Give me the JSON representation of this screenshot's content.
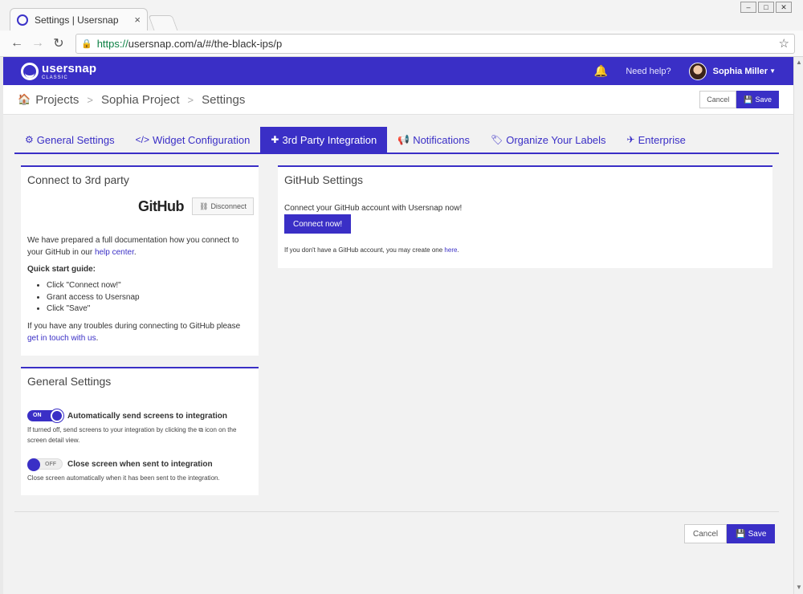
{
  "browser": {
    "tab_title": "Settings | Usersnap",
    "tab_close": "×",
    "url_scheme": "https://",
    "url_rest": "usersnap.com/a/#/the-black-ips/p"
  },
  "appbar": {
    "logo_word": "usersnap",
    "logo_sub": "CLASSIC",
    "help": "Need help?",
    "user": "Sophia Miller"
  },
  "breadcrumb": {
    "items": [
      "Projects",
      "Sophia Project",
      "Settings"
    ],
    "cancel": "Cancel",
    "save": "Save"
  },
  "tabs": [
    {
      "label": "General Settings",
      "icon": "gear-icon"
    },
    {
      "label": "Widget Configuration",
      "icon": "code-icon"
    },
    {
      "label": "3rd Party Integration",
      "icon": "puzzle-icon",
      "active": true
    },
    {
      "label": "Notifications",
      "icon": "megaphone-icon"
    },
    {
      "label": "Organize Your Labels",
      "icon": "tags-icon"
    },
    {
      "label": "Enterprise",
      "icon": "plane-icon"
    }
  ],
  "connect_panel": {
    "title": "Connect to 3rd party",
    "github_logo": "GitHub",
    "disconnect": "Disconnect",
    "intro_pre": "We have prepared a full documentation how you connect to your GitHub in our ",
    "intro_link": "help center",
    "intro_post": ".",
    "guide_title": "Quick start guide:",
    "guide_steps": [
      "Click \"Connect now!\"",
      "Grant access to Usersnap",
      "Click \"Save\""
    ],
    "trouble_pre": "If you have any troubles during connecting to GitHub please ",
    "trouble_link": "get in touch with us",
    "trouble_post": "."
  },
  "general_panel": {
    "title": "General Settings",
    "toggle1": {
      "state": "ON",
      "label": "Automatically send screens to integration",
      "desc_pre": "If turned off, send screens to your integration by clicking the ",
      "desc_post": " icon on the screen detail view."
    },
    "toggle2": {
      "state": "OFF",
      "label": "Close screen when sent to integration",
      "desc": "Close screen automatically when it has been sent to the integration."
    }
  },
  "github_panel": {
    "title": "GitHub Settings",
    "desc": "Connect your GitHub account with Usersnap now!",
    "connect": "Connect now!",
    "note_pre": "If you don't have a GitHub account, you may create one ",
    "note_link": "here",
    "note_post": "."
  },
  "footer": {
    "cancel": "Cancel",
    "save": "Save"
  },
  "colors": {
    "brand": "#3a2fc6"
  }
}
